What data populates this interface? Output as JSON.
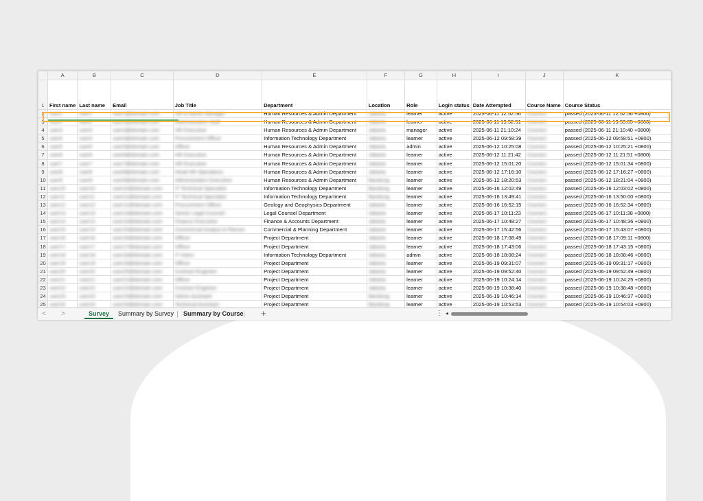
{
  "columns": [
    "A",
    "B",
    "C",
    "D",
    "E",
    "F",
    "G",
    "H",
    "I",
    "J",
    "K"
  ],
  "header_row": {
    "row_number": "1",
    "cells": [
      "First name",
      "Last name",
      "Email",
      "Job Title",
      "Department",
      "Location",
      "Role",
      "Login status",
      "Date Attempted",
      "Course Name",
      "Course Status"
    ]
  },
  "rows": [
    {
      "n": "2",
      "cells": [
        "user1",
        "user1",
        "user1@domain.com",
        "HR & Admin Manager",
        "Human Resources & Admin Department",
        "Jakarta",
        "learner",
        "active",
        "2025-06-11 12:52:56",
        "Course1",
        "passed (2025-06-11 12:52:56 +0800)"
      ]
    },
    {
      "n": "3",
      "cells": [
        "user2",
        "user2",
        "user2@domain.com",
        "Administration Staff",
        "Human Resources & Admin Department",
        "Jakarta",
        "learner",
        "active",
        "2025-06-11 19:52:51",
        "Course1",
        "passed (2025-06-11 19:53:05 +0800)"
      ]
    },
    {
      "n": "4",
      "cells": [
        "user3",
        "user3",
        "user3@domain.com",
        "HR Executive",
        "Human Resources & Admin Department",
        "Jakarta",
        "manager",
        "active",
        "2025-06-11 21:10:24",
        "Course1",
        "passed (2025-06-11 21:10:40 +0800)"
      ]
    },
    {
      "n": "5",
      "cells": [
        "user4",
        "user4",
        "user4@domain.com",
        "Procurement Officer",
        "Information Technology Department",
        "Jakarta",
        "learner",
        "active",
        "2025-06-12 09:58:39",
        "Course1",
        "passed (2025-06-12 09:58:51 +0800)"
      ]
    },
    {
      "n": "6",
      "cells": [
        "user5",
        "user5",
        "user5@domain.com",
        "Officer",
        "Human Resources & Admin Department",
        "Jakarta",
        "admin",
        "active",
        "2025-06-12 10:25:08",
        "Course1",
        "passed (2025-06-12 10:25:21 +0800)"
      ]
    },
    {
      "n": "7",
      "cells": [
        "user6",
        "user6",
        "user6@domain.com",
        "HR Executive",
        "Human Resources & Admin Department",
        "Jakarta",
        "learner",
        "active",
        "2025-06-12 11:21:42",
        "Course1",
        "passed (2025-06-12 11:21:51 +0800)"
      ]
    },
    {
      "n": "8",
      "cells": [
        "user7",
        "user7",
        "user7@domain.com",
        "HR Executive",
        "Human Resources & Admin Department",
        "Jakarta",
        "learner",
        "active",
        "2025-06-12 15:01:20",
        "Course1",
        "passed (2025-06-12 15:01:34 +0800)"
      ]
    },
    {
      "n": "9",
      "cells": [
        "user8",
        "user8",
        "user8@domain.com",
        "Head HR Operations",
        "Human Resources & Admin Department",
        "Jakarta",
        "learner",
        "active",
        "2025-06-12 17:16:10",
        "Course1",
        "passed (2025-06-12 17:16:27 +0800)"
      ]
    },
    {
      "n": "10",
      "cells": [
        "user9",
        "user9",
        "user9@domain.com",
        "Administration Executive",
        "Human Resources & Admin Department",
        "Bandung",
        "learner",
        "active",
        "2025-06-12 18:20:53",
        "Course1",
        "passed (2025-06-12 18:21:04 +0800)"
      ]
    },
    {
      "n": "11",
      "cells": [
        "user10",
        "user10",
        "user10@domain.com",
        "IT Technical Specialist",
        "Information Technology Department",
        "Bandung",
        "learner",
        "active",
        "2025-06-16 12:02:49",
        "Course1",
        "passed (2025-06-16 12:03:02 +0800)"
      ]
    },
    {
      "n": "12",
      "cells": [
        "user11",
        "user11",
        "user11@domain.com",
        "IT Technical Specialist",
        "Information Technology Department",
        "Bandung",
        "learner",
        "active",
        "2025-06-16 13:49:41",
        "Course1",
        "passed (2025-06-16 13:50:00 +0800)"
      ]
    },
    {
      "n": "13",
      "cells": [
        "user12",
        "user12",
        "user12@domain.com",
        "Procurement Officer",
        "Geology and Geophysics Department",
        "Jakarta",
        "learner",
        "active",
        "2025-06-16 16:52:15",
        "Course1",
        "passed (2025-06-16 16:52:34 +0800)"
      ]
    },
    {
      "n": "14",
      "cells": [
        "user13",
        "user13",
        "user13@domain.com",
        "Senior Legal Counsel",
        "Legal Counsel Department",
        "Jakarta",
        "learner",
        "active",
        "2025-06-17 10:11:23",
        "Course1",
        "passed (2025-06-17 10:11:38 +0800)"
      ]
    },
    {
      "n": "15",
      "cells": [
        "user14",
        "user14",
        "user14@domain.com",
        "Finance Executive",
        "Finance & Accounts Department",
        "Jakarta",
        "learner",
        "active",
        "2025-06-17 10:48:27",
        "Course1",
        "passed (2025-06-17 10:48:36 +0800)"
      ]
    },
    {
      "n": "16",
      "cells": [
        "user15",
        "user15",
        "user15@domain.com",
        "Commercial Analyst & Planner",
        "Commercial & Planning Department",
        "Jakarta",
        "learner",
        "active",
        "2025-06-17 15:42:56",
        "Course1",
        "passed (2025-06-17 15:43:07 +0800)"
      ]
    },
    {
      "n": "17",
      "cells": [
        "user16",
        "user16",
        "user16@domain.com",
        "Officer",
        "Project Department",
        "Jakarta",
        "learner",
        "active",
        "2025-06-18 17:08:49",
        "Course1",
        "passed (2025-06-18 17:09:11 +0800)"
      ]
    },
    {
      "n": "18",
      "cells": [
        "user17",
        "user17",
        "user17@domain.com",
        "Officer",
        "Project Department",
        "Jakarta",
        "learner",
        "active",
        "2025-06-18 17:43:06",
        "Course1",
        "passed (2025-06-18 17:43:15 +0800)"
      ]
    },
    {
      "n": "19",
      "cells": [
        "user18",
        "user18",
        "user18@domain.com",
        "IT Intern",
        "Information Technology Department",
        "Jakarta",
        "admin",
        "active",
        "2025-06-18 18:08:24",
        "Course1",
        "passed (2025-06-18 18:08:46 +0800)"
      ]
    },
    {
      "n": "20",
      "cells": [
        "user19",
        "user19",
        "user19@domain.com",
        "Officer",
        "Project Department",
        "Jakarta",
        "learner",
        "active",
        "2025-06-19 09:31:07",
        "Course1",
        "passed (2025-06-19 09:31:17 +0800)"
      ]
    },
    {
      "n": "21",
      "cells": [
        "user20",
        "user20",
        "user20@domain.com",
        "Contract Engineer",
        "Project Department",
        "Jakarta",
        "learner",
        "active",
        "2025-06-19 09:52:40",
        "Course1",
        "passed (2025-06-19 09:52:49 +0800)"
      ]
    },
    {
      "n": "22",
      "cells": [
        "user21",
        "user21",
        "user21@domain.com",
        "Officer",
        "Project Department",
        "Jakarta",
        "learner",
        "active",
        "2025-06-19 10:24:14",
        "Course1",
        "passed (2025-06-19 10:24:25 +0800)"
      ]
    },
    {
      "n": "23",
      "cells": [
        "user22",
        "user22",
        "user22@domain.com",
        "Contract Engineer",
        "Project Department",
        "Jakarta",
        "learner",
        "active",
        "2025-06-19 10:38:40",
        "Course1",
        "passed (2025-06-19 10:38:48 +0800)"
      ]
    },
    {
      "n": "24",
      "cells": [
        "user23",
        "user23",
        "user23@domain.com",
        "Admin Assistant",
        "Project Department",
        "Bandung",
        "learner",
        "active",
        "2025-06-19 10:46:14",
        "Course1",
        "passed (2025-06-19 10:46:37 +0800)"
      ]
    },
    {
      "n": "25",
      "cells": [
        "user24",
        "user24",
        "user24@domain.com",
        "Technical Assistant",
        "Project Department",
        "Bandung",
        "learner",
        "active",
        "2025-06-19 10:53:53",
        "Course1",
        "passed (2025-06-19 10:54:03 +0800)"
      ]
    }
  ],
  "blurred_columns": [
    0,
    1,
    2,
    3,
    5,
    9
  ],
  "tabs": [
    {
      "label": "Survey",
      "active": true
    },
    {
      "label": "Summary by Survey",
      "active": false
    },
    {
      "label": "Summary by Course",
      "active": false
    }
  ],
  "tabbar": {
    "add_label": "+",
    "nav_prev": "<",
    "nav_next": ">",
    "more": "⋮",
    "scroll_left": "◂"
  },
  "colors": {
    "selection_border": "#f5b13a",
    "active_tab": "#1e7145"
  }
}
